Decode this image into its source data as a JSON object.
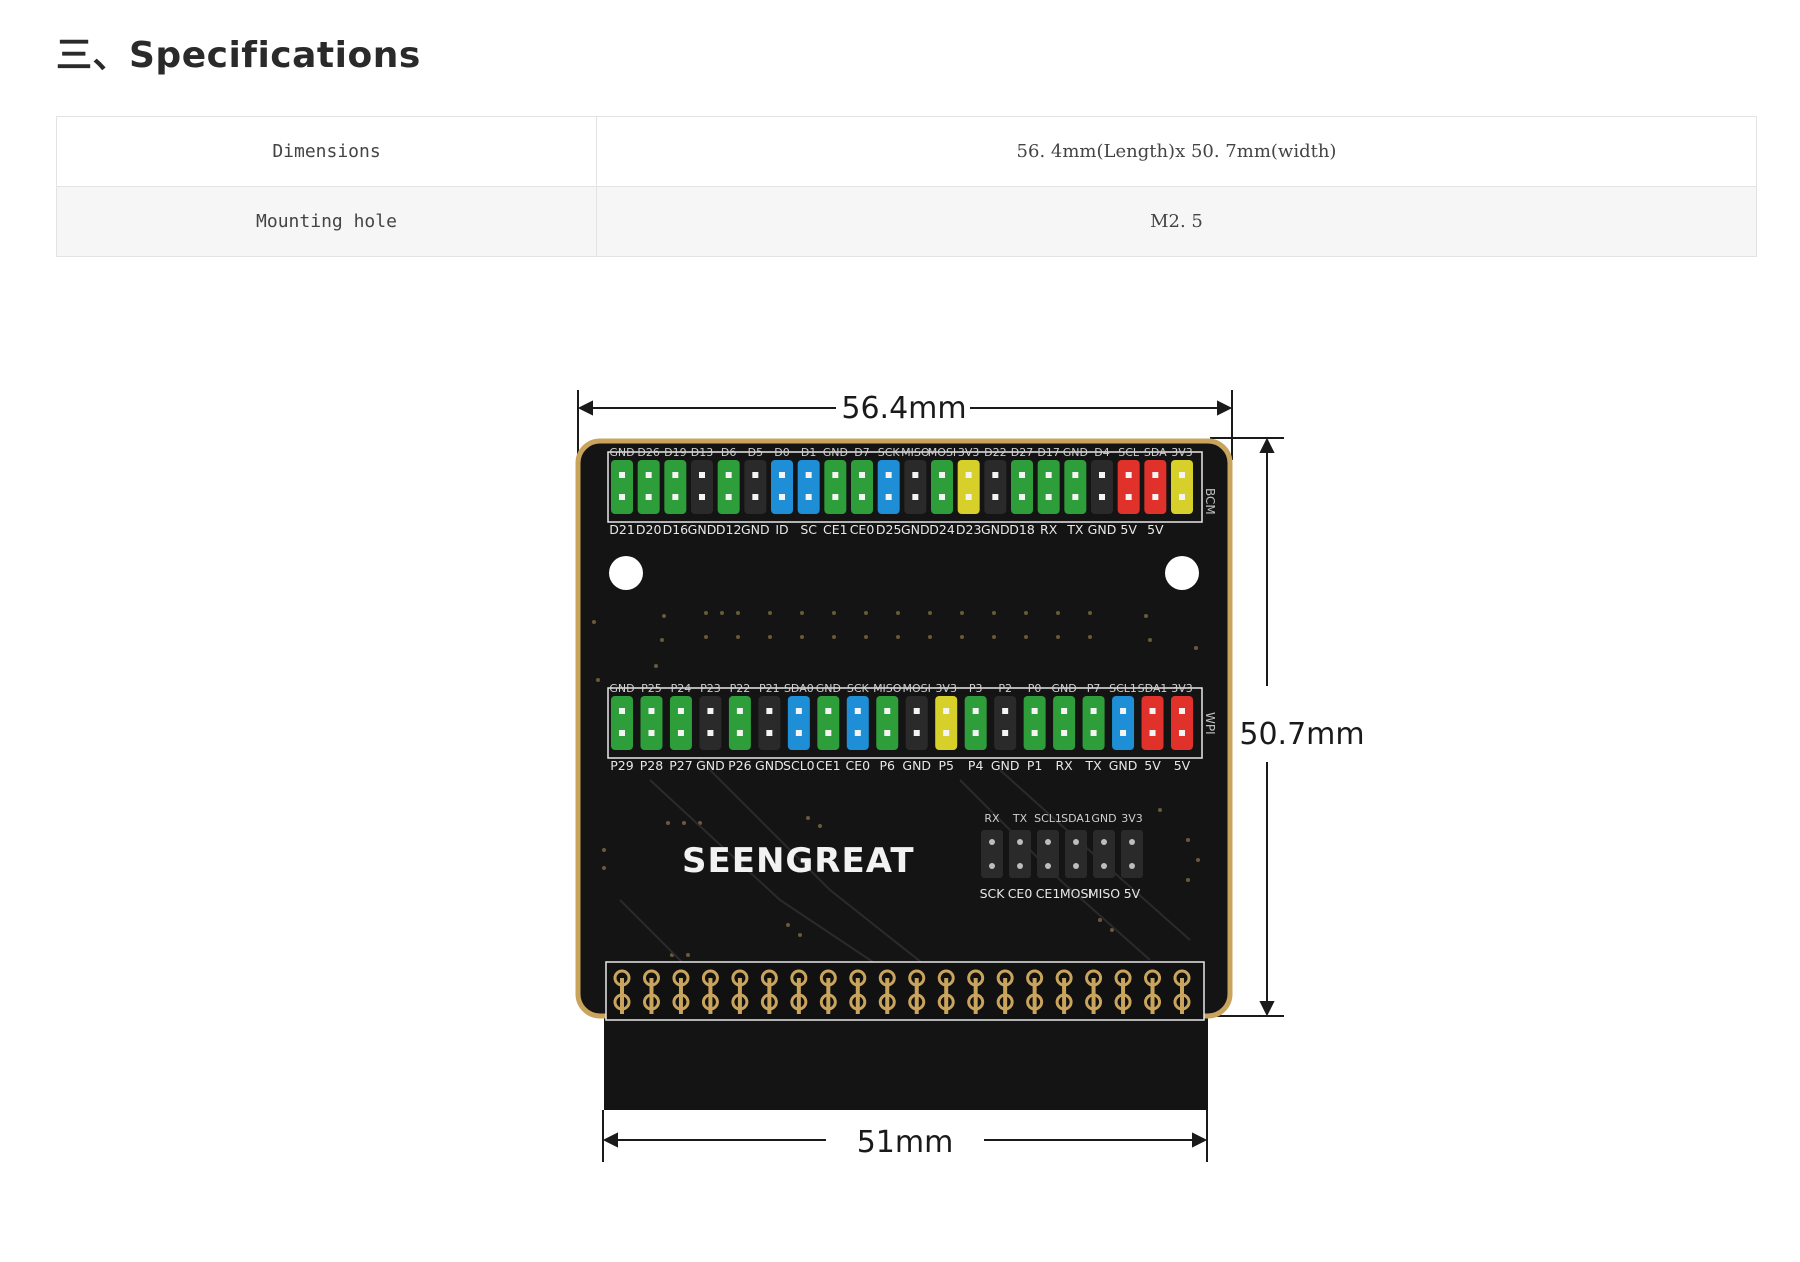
{
  "heading": "三、Specifications",
  "specs": [
    {
      "key": "Dimensions",
      "value": "56. 4mm(Length)x  50. 7mm(width)"
    },
    {
      "key": "Mounting hole",
      "value": "M2. 5"
    }
  ],
  "diagram": {
    "length_label": "56.4mm",
    "height_label": "50.7mm",
    "bottom_label": "51mm",
    "logo": "SEENGREAT",
    "bcm_tag": "BCM",
    "wpi_tag": "WPI",
    "row1_top": [
      "GND",
      "D26",
      "D19",
      "D13",
      "D6",
      "D5",
      "D0",
      "D1",
      "GND",
      "D7",
      "SCK",
      "MISO",
      "MOSI",
      "3V3",
      "D22",
      "D27",
      "D17",
      "GND",
      "D4",
      "SCL",
      "SDA",
      "3V3"
    ],
    "row1_bottom": [
      "D21",
      "D20",
      "D16",
      "GND",
      "D12",
      "GND",
      "ID",
      "SC",
      "CE1",
      "CE0",
      "D25",
      "GND",
      "D24",
      "D23",
      "GND",
      "D18",
      "RX",
      "TX",
      "GND",
      "5V",
      "5V"
    ],
    "row2_top": [
      "GND",
      "P25",
      "P24",
      "P23",
      "P22",
      "P21",
      "SDA0",
      "GND",
      "SCK",
      "MISO",
      "MOSI",
      "3V3",
      "P3",
      "P2",
      "P0",
      "GND",
      "P7",
      "SCL1",
      "SDA1",
      "3V3"
    ],
    "row2_bottom": [
      "P29",
      "P28",
      "P27",
      "GND",
      "P26",
      "GND",
      "SCL0",
      "CE1",
      "CE0",
      "P6",
      "GND",
      "P5",
      "P4",
      "GND",
      "P1",
      "RX",
      "TX",
      "GND",
      "5V",
      "5V"
    ],
    "small_top": [
      "RX",
      "TX",
      "SCL1",
      "SDA1",
      "GND",
      "3V3"
    ],
    "small_bottom": [
      "SCK",
      "CE0",
      "CE1",
      "MOSI",
      "MISO",
      "5V"
    ],
    "colors": {
      "pcb": "#141414",
      "gold": "#c9a45c",
      "green": "#2e9e3a",
      "blue": "#1e8fd6",
      "yellow": "#d8d02a",
      "red": "#e0322a",
      "black_header": "#2a2a2a"
    }
  }
}
